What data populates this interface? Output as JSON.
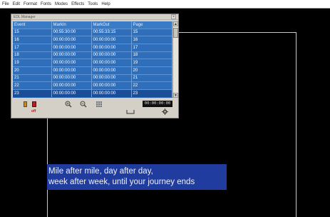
{
  "menu": [
    "File",
    "Edit",
    "Format",
    "Fonts",
    "Modes",
    "Effects",
    "Tools",
    "Help"
  ],
  "edl_window": {
    "title": "EDL Manager",
    "close_glyph": "×",
    "columns": [
      "Event",
      "MarkIn",
      "MarkOut",
      "Page"
    ],
    "rows": [
      {
        "event": "15",
        "mark_in": "00:55:30:00",
        "mark_out": "00:55:33:15",
        "page": "15"
      },
      {
        "event": "16",
        "mark_in": "00:00:00:00",
        "mark_out": "00:00:00:00",
        "page": "16"
      },
      {
        "event": "17",
        "mark_in": "00:00:00:00",
        "mark_out": "00:00:00:00",
        "page": "17"
      },
      {
        "event": "18",
        "mark_in": "00:00:00:00",
        "mark_out": "00:00:00:00",
        "page": "18"
      },
      {
        "event": "19",
        "mark_in": "00:00:00:00",
        "mark_out": "00:00:00:00",
        "page": "19"
      },
      {
        "event": "20",
        "mark_in": "00:00:00:00",
        "mark_out": "00:00:00:00",
        "page": "20"
      },
      {
        "event": "21",
        "mark_in": "00:00:00:00",
        "mark_out": "00:00:00:00",
        "page": "21"
      },
      {
        "event": "22",
        "mark_in": "00:00:00:00",
        "mark_out": "00:00:00:00",
        "page": "22"
      },
      {
        "event": "23",
        "mark_in": "00:00:00:00",
        "mark_out": "00:00:00:00",
        "page": "23"
      }
    ],
    "selected_row_index": 8,
    "off_label": "off",
    "timecode": "00:00:00:00",
    "icons": [
      "mark-in-icon",
      "mark-out-icon",
      "zoom-in-icon",
      "zoom-out-icon",
      "grid-icon",
      "tray-icon",
      "gear-icon"
    ]
  },
  "subtitle": {
    "line1": "Mile after mile, day after day,",
    "line2": "week after week, until your journey ends"
  },
  "colors": {
    "grid_bg": "#2f6eba",
    "selected_row": "#1b4e96",
    "subtitle_bg": "#1f3c9e",
    "off_label": "#cc1111"
  }
}
